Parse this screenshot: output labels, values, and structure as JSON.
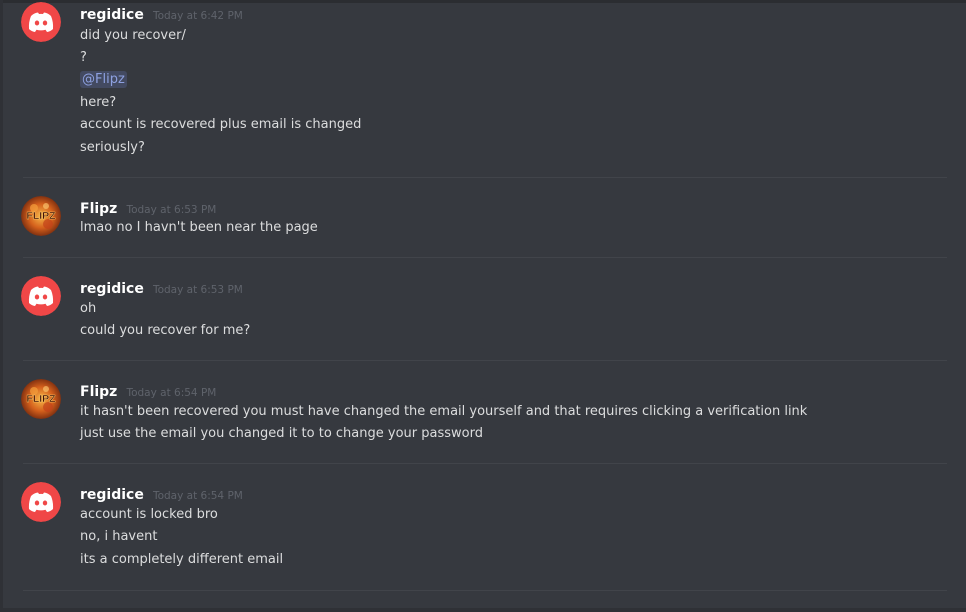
{
  "messages": [
    {
      "author": "regidice",
      "avatar": "discord-logo-icon",
      "timestamp": "Today at 6:42 PM",
      "lines": [
        "did you recover/",
        "?",
        "@Flipz",
        "here?",
        "account is recovered plus email is changed",
        "seriously?"
      ]
    },
    {
      "author": "Flipz",
      "avatar": "flipz-avatar-icon",
      "avatar_text": "FLIPZ",
      "timestamp": "Today at 6:53 PM",
      "lines": [
        "lmao no I havn't been near the page"
      ]
    },
    {
      "author": "regidice",
      "avatar": "discord-logo-icon",
      "timestamp": "Today at 6:53 PM",
      "lines": [
        "oh",
        "could you recover for me?"
      ]
    },
    {
      "author": "Flipz",
      "avatar": "flipz-avatar-icon",
      "avatar_text": "FLIPZ",
      "timestamp": "Today at 6:54 PM",
      "lines": [
        "it hasn't been recovered you must have changed the email yourself and that requires clicking a verification link",
        "just use the email you changed it to to change your password"
      ]
    },
    {
      "author": "regidice",
      "avatar": "discord-logo-icon",
      "timestamp": "Today at 6:54 PM",
      "lines": [
        "account is locked bro",
        "no, i havent",
        "its a completely different email"
      ]
    }
  ],
  "colors": {
    "background": "#36393f",
    "discord_red": "#f04747",
    "mention_text": "#8ea1e1",
    "username": "#ffffff",
    "message_text": "#dcddde",
    "timestamp": "#5f636b"
  }
}
